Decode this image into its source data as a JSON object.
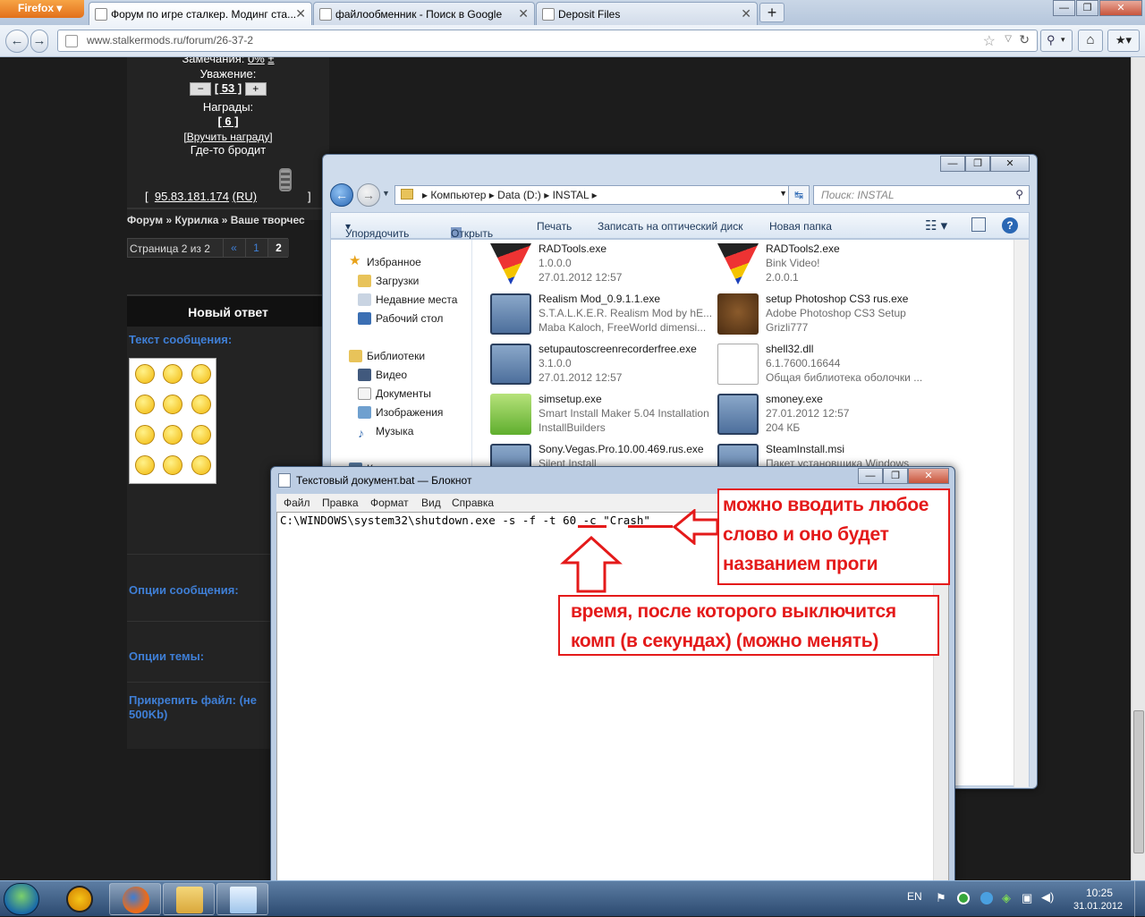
{
  "browser": {
    "menu_label": "Firefox",
    "tabs": [
      {
        "title": "Форум по игре сталкер. Модинг ста..."
      },
      {
        "title": "файлообменник - Поиск в Google"
      },
      {
        "title": "Deposit Files"
      }
    ],
    "url_host": "www.stalkermods.ru",
    "url_path": "/forum/26-37-2"
  },
  "forum": {
    "warnings_label": "Замечания:",
    "warnings_value": "0%",
    "warnings_pm": "±",
    "respect_label": "Уважение:",
    "respect_minus": "−",
    "respect_value": "[ 53 ]",
    "respect_plus": "+",
    "awards_label": "Награды:",
    "awards_value": "[ 6 ]",
    "give_award": "[Вручить награду]",
    "location": "Где-то бродит",
    "ip_open": "[",
    "ip": "95.83.181.174",
    "country": "(RU)",
    "ip_close": "]",
    "breadcrumb": [
      "Форум",
      "»",
      "Курилка",
      "»",
      "Ваше творчес"
    ],
    "pager_text": "Страница 2 из 2",
    "pager_prev": "«",
    "pager_pages": [
      "1",
      "2"
    ],
    "new_reply": "Новый ответ",
    "message_text_label": "Текст сообщения:",
    "message_options_label": "Опции сообщения:",
    "topic_options_label": "Опции темы:",
    "attach_label": "Прикрепить файл: (не",
    "attach_label2": "500Kb)"
  },
  "explorer": {
    "breadcrumb": [
      "Компьютер",
      "Data (D:)",
      "INSTAL"
    ],
    "search_placeholder": "Поиск: INSTAL",
    "toolbar": [
      "Упорядочить",
      "Открыть",
      "Печать",
      "Записать на оптический диск",
      "Новая папка"
    ],
    "nav": {
      "favorites": "Избранное",
      "downloads": "Загрузки",
      "recent": "Недавние места",
      "desktop": "Рабочий стол",
      "libraries": "Библиотеки",
      "video": "Видео",
      "documents": "Документы",
      "images": "Изображения",
      "music": "Музыка",
      "computer": "Компьютер"
    },
    "files": [
      {
        "name": "RADTools.exe",
        "line2": "1.0.0.0",
        "line3": "27.01.2012 12:57",
        "icon": "bink-video-icon"
      },
      {
        "name": "RADTools2.exe",
        "line2": "Bink Video!",
        "line3": "2.0.0.1",
        "icon": "bink-video-icon"
      },
      {
        "name": "Realism Mod_0.9.1.1.exe",
        "line2": "S.T.A.L.K.E.R. Realism Mod by hE...",
        "line3": "Maba Kaloch, FreeWorld dimensi...",
        "icon": "installer-icon"
      },
      {
        "name": "setup Photoshop CS3 rus.exe",
        "line2": "Adobe Photoshop CS3 Setup",
        "line3": "Grizli777",
        "icon": "bear-icon"
      },
      {
        "name": "setupautoscreenrecorderfree.exe",
        "line2": "3.1.0.0",
        "line3": "27.01.2012 12:57",
        "icon": "installer-icon"
      },
      {
        "name": "shell32.dll",
        "line2": "6.1.7600.16644",
        "line3": "Общая библиотека оболочки ...",
        "icon": "dll-icon"
      },
      {
        "name": "simsetup.exe",
        "line2": "Smart Install Maker 5.04 Installation",
        "line3": "InstallBuilders",
        "icon": "box-icon"
      },
      {
        "name": "smoney.exe",
        "line2": "27.01.2012 12:57",
        "line3": "204 КБ",
        "icon": "installer-icon"
      },
      {
        "name": "Sony.Vegas.Pro.10.00.469.rus.exe",
        "line2": "Silent Install",
        "line3": "",
        "icon": "installer-icon"
      },
      {
        "name": "SteamInstall.msi",
        "line2": "Пакет установщика Windows",
        "line3": "",
        "icon": "installer-icon"
      }
    ]
  },
  "notepad": {
    "title": "Текстовый документ.bat — Блокнот",
    "menu": [
      "Файл",
      "Правка",
      "Формат",
      "Вид",
      "Справка"
    ],
    "content_line": "C:\\WINDOWS\\system32\\shutdown.exe -s -f -t 60 -c \"Crash\""
  },
  "annotations": {
    "name_note": [
      "можно вводить любое",
      "слово и оно будет",
      "названием проги"
    ],
    "time_note": [
      "время, после которого выключится",
      "комп (в секундах) (можно менять)"
    ],
    "color": "#e41a1a"
  },
  "taskbar": {
    "language": "EN",
    "time": "10:25",
    "date": "31.01.2012"
  }
}
